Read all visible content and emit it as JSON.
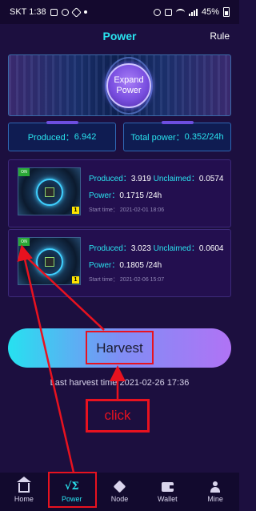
{
  "status_bar": {
    "carrier_time": "SKT 1:38",
    "battery": "45%"
  },
  "header": {
    "title": "Power",
    "rule_label": "Rule"
  },
  "banner": {
    "expand_button_label_1": "Expand",
    "expand_button_label_2": "Power"
  },
  "stats": {
    "produced_label": "Produced：",
    "produced_value": "6.942",
    "total_power_label": "Total power：",
    "total_power_value": "0.352/24h"
  },
  "miners": [
    {
      "produced_label": "Produced：",
      "produced_value": "3.919",
      "unclaimed_label": "Unclaimed：",
      "unclaimed_value": "0.0574",
      "power_label": "Power：",
      "power_value": "0.1715",
      "power_unit": "/24h",
      "start_time_label": "Start time：",
      "start_time_value": "2021-02-01 18:06",
      "badge_on": "ON",
      "level": "1"
    },
    {
      "produced_label": "Produced：",
      "produced_value": "3.023",
      "unclaimed_label": "Unclaimed：",
      "unclaimed_value": "0.0604",
      "power_label": "Power：",
      "power_value": "0.1805",
      "power_unit": "/24h",
      "start_time_label": "Start time：",
      "start_time_value": "2021-02-06 15:07",
      "badge_on": "ON",
      "level": "1"
    }
  ],
  "harvest": {
    "button_label": "Harvest",
    "last_harvest_text": "Last harvest time 2021-02-26 17:36"
  },
  "annotation": {
    "click_label": "click",
    "color": "#e8121f"
  },
  "bottom_nav": {
    "items": [
      {
        "label": "Home",
        "icon": "home-icon"
      },
      {
        "label": "Power",
        "icon": "sqrt-sigma-icon"
      },
      {
        "label": "Node",
        "icon": "cube-icon"
      },
      {
        "label": "Wallet",
        "icon": "wallet-icon"
      },
      {
        "label": "Mine",
        "icon": "person-icon"
      }
    ],
    "active": "Power"
  },
  "colors": {
    "accent": "#29e3ef",
    "background": "#1c0f3f",
    "highlight": "#e8121f"
  }
}
